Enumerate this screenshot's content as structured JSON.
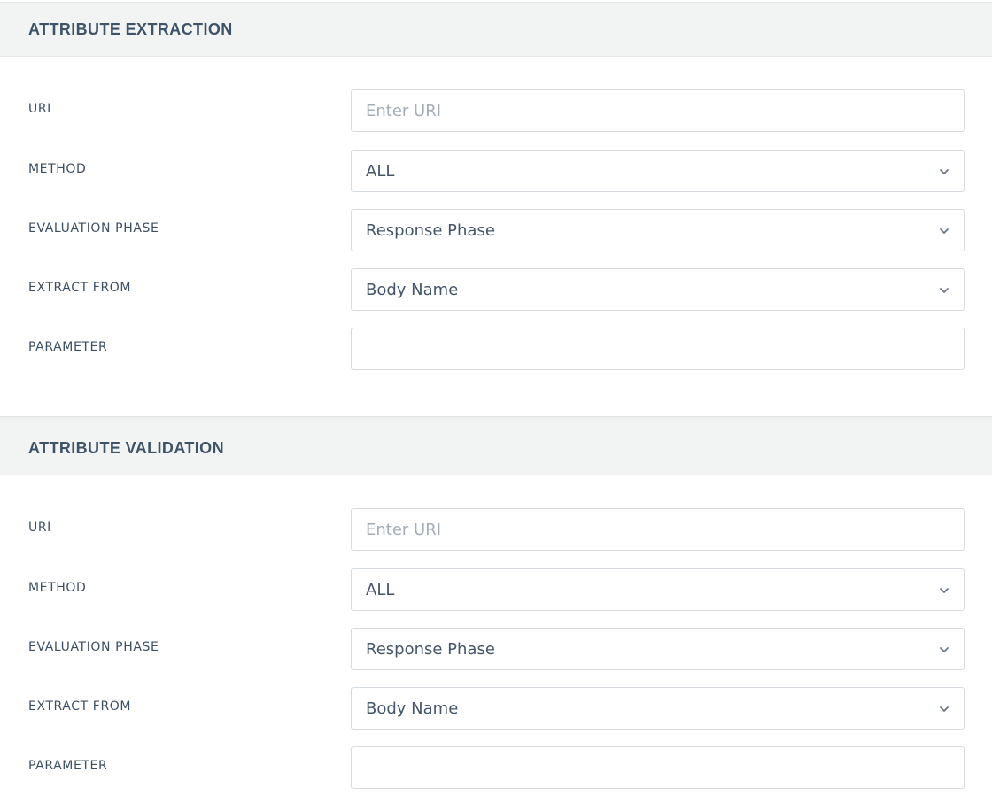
{
  "sections": [
    {
      "title": "ATTRIBUTE EXTRACTION",
      "uri": {
        "label": "URI",
        "placeholder": "Enter URI",
        "value": ""
      },
      "method": {
        "label": "METHOD",
        "value": "ALL"
      },
      "evaluation_phase": {
        "label": "EVALUATION PHASE",
        "value": "Response Phase"
      },
      "extract_from": {
        "label": "EXTRACT FROM",
        "value": "Body Name"
      },
      "parameter": {
        "label": "PARAMETER",
        "value": ""
      }
    },
    {
      "title": "ATTRIBUTE VALIDATION",
      "uri": {
        "label": "URI",
        "placeholder": "Enter URI",
        "value": ""
      },
      "method": {
        "label": "METHOD",
        "value": "ALL"
      },
      "evaluation_phase": {
        "label": "EVALUATION PHASE",
        "value": "Response Phase"
      },
      "extract_from": {
        "label": "EXTRACT FROM",
        "value": "Body Name"
      },
      "parameter": {
        "label": "PARAMETER",
        "value": ""
      }
    }
  ],
  "icons": {
    "dropdown": "chevron-down-icon"
  },
  "colors": {
    "header_bg": "#f2f3f3",
    "text": "#44546a",
    "border": "#d6dbe0",
    "placeholder": "#a3adb8"
  }
}
